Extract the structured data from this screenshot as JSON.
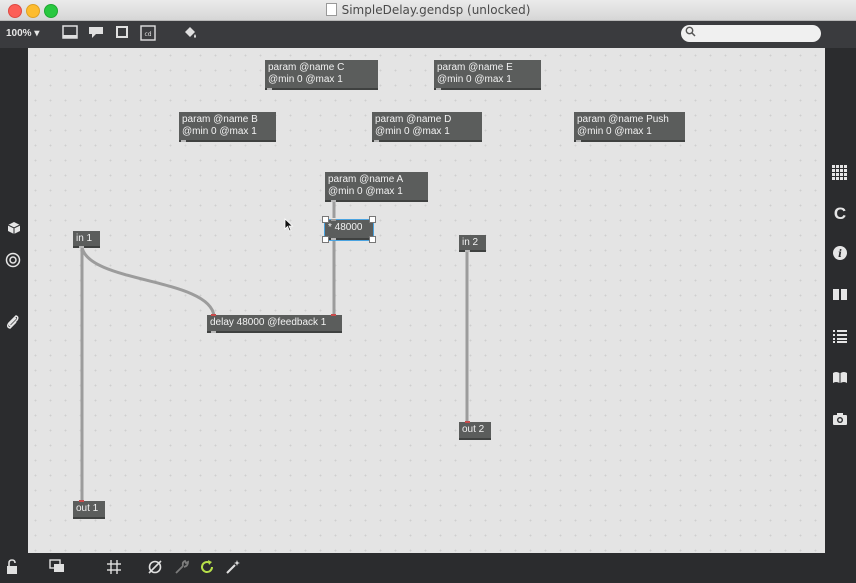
{
  "window": {
    "title": "SimpleDelay.gendsp (unlocked)"
  },
  "toolbar": {
    "zoom": "100%",
    "icons": [
      "presentation-icon",
      "comment-icon",
      "fullscreen-icon",
      "codebox-icon",
      "paint-bucket-icon"
    ],
    "search_placeholder": ""
  },
  "left_sidebar": {
    "icons": [
      "cube-icon",
      "target-icon",
      "paperclip-icon"
    ]
  },
  "right_sidebar": {
    "icons": [
      "grid-icon",
      "c-icon",
      "info-icon",
      "split-view-icon",
      "list-icon",
      "book-icon",
      "camera-icon"
    ]
  },
  "bottom_bar": {
    "icons": [
      "lock-icon",
      "windows-icon",
      "grid-snap-icon",
      "mute-icon",
      "wrench-icon",
      "refresh-icon",
      "magic-icon"
    ]
  },
  "patch": {
    "objects": {
      "param_c": {
        "line1": "param @name C",
        "line2": "@min 0 @max 1"
      },
      "param_e": {
        "line1": "param @name E",
        "line2": "@min 0 @max 1"
      },
      "param_b": {
        "line1": "param @name B",
        "line2": "@min 0 @max 1"
      },
      "param_d": {
        "line1": "param @name D",
        "line2": "@min 0 @max 1"
      },
      "param_push": {
        "line1": "param @name Push",
        "line2": "@min 0 @max 1"
      },
      "param_a": {
        "line1": "param @name A",
        "line2": "@min 0 @max 1"
      },
      "mult": {
        "line1": "* 48000"
      },
      "in1": {
        "line1": "in 1"
      },
      "in2": {
        "line1": "in 2"
      },
      "delay": {
        "line1": "delay 48000 @feedback 1"
      },
      "out1": {
        "line1": "out 1"
      },
      "out2": {
        "line1": "out 2"
      }
    }
  }
}
